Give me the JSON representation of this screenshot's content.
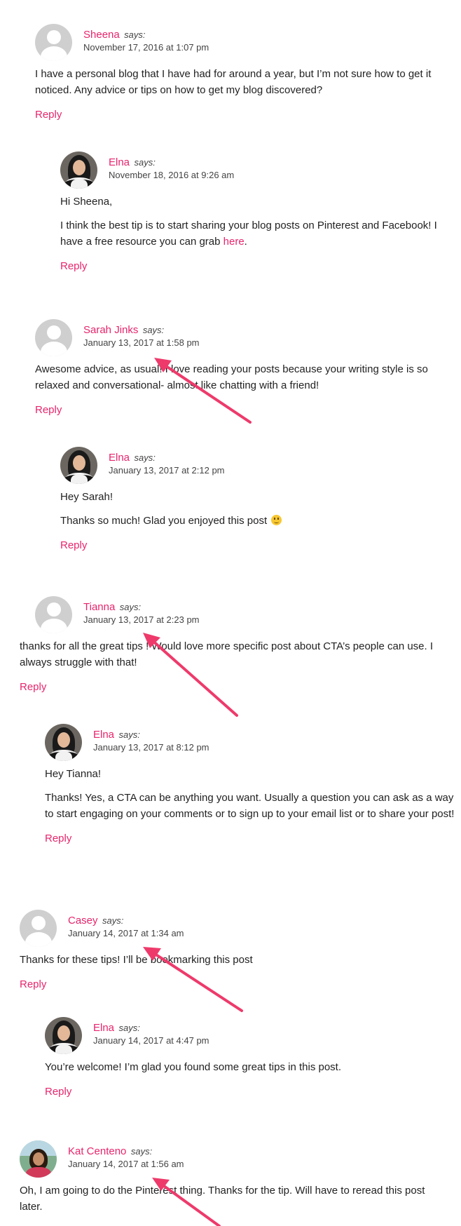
{
  "says_label": "says:",
  "reply_label": "Reply",
  "colors": {
    "accent": "#e8246c",
    "arrow": "#ee3a6b"
  },
  "comments": [
    {
      "author": "Sheena",
      "date": "November 17, 2016 at 1:07 pm",
      "paragraphs": [
        "I have a personal blog that I have had for around a year, but I’m not sure how to get it noticed. Any advice or tips on how to get my blog discovered?"
      ]
    },
    {
      "author": "Elna",
      "date": "November 18, 2016 at 9:26 am",
      "paragraphs": [
        "Hi Sheena,"
      ],
      "p2_text": "I think the best tip is to start sharing your blog posts on Pinterest and Facebook! I have a free resource you can grab ",
      "p2_link": "here",
      "p2_end": "."
    },
    {
      "author": "Sarah Jinks",
      "date": "January 13, 2017 at 1:58 pm",
      "paragraphs": [
        "Awesome advice, as usual! I love reading your posts because your writing style is so relaxed and conversational- almost like chatting with a friend!"
      ]
    },
    {
      "author": "Elna",
      "date": "January 13, 2017 at 2:12 pm",
      "paragraphs": [
        "Hey Sarah!",
        "Thanks so much! Glad you enjoyed this post"
      ]
    },
    {
      "author": "Tianna",
      "date": "January 13, 2017 at 2:23 pm",
      "paragraphs": [
        "thanks for all the great tips ! Would love more specific post about CTA’s people can use. I always struggle with that!"
      ]
    },
    {
      "author": "Elna",
      "date": "January 13, 2017 at 8:12 pm",
      "paragraphs": [
        "Hey Tianna!",
        "Thanks! Yes, a CTA can be anything you want. Usually a question you can ask as a way to start engaging on your comments or to sign up to your email list or to share your post!"
      ]
    },
    {
      "author": "Casey",
      "date": "January 14, 2017 at 1:34 am",
      "paragraphs": [
        "Thanks for these tips! I’ll be bookmarking this post"
      ]
    },
    {
      "author": "Elna",
      "date": "January 14, 2017 at 4:47 pm",
      "paragraphs": [
        "You’re welcome! I’m glad you found some great tips in this post."
      ]
    },
    {
      "author": "Kat Centeno",
      "date": "January 14, 2017 at 1:56 am",
      "paragraphs": [
        "Oh, I am going to do the Pinterest thing. Thanks for the tip. Will have to reread this post later."
      ]
    }
  ]
}
